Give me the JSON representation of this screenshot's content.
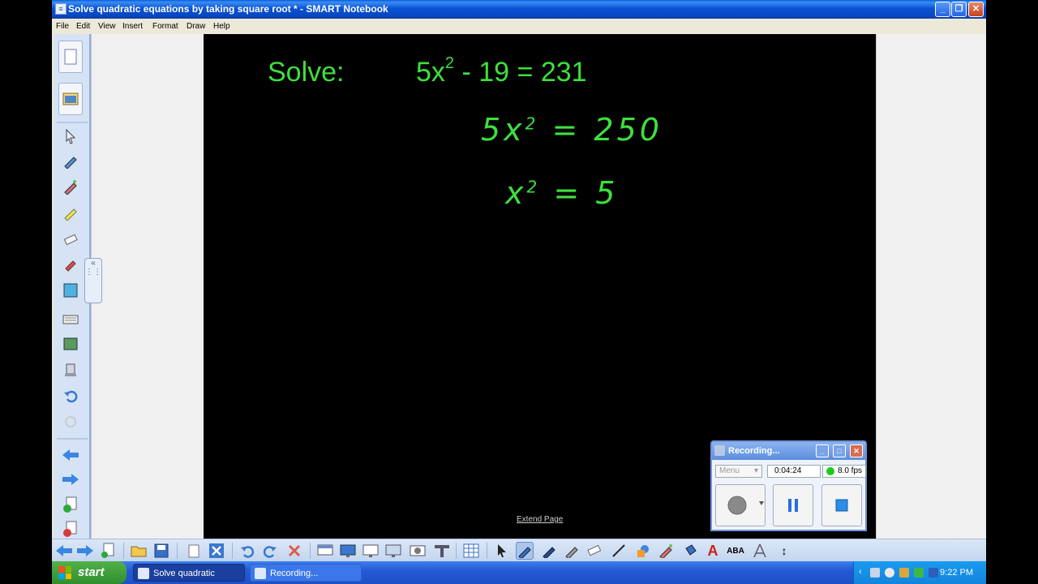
{
  "window": {
    "title": "Solve quadratic equations by taking square root * - SMART Notebook"
  },
  "menu": [
    "File",
    "Edit",
    "View",
    "Insert",
    "Format",
    "Draw",
    "Help"
  ],
  "canvas": {
    "solve_label": "Solve:",
    "equation_base": "5x",
    "equation_exp": "2",
    "equation_rest": " - 19 = 231",
    "step1_left": "5x",
    "step1_exp": "2",
    "step1_right": " = 250",
    "step2_left": "x",
    "step2_exp": "2",
    "step2_right": " = 5",
    "extend_page": "Extend Page"
  },
  "recorder": {
    "title": "Recording...",
    "menu_label": "Menu",
    "time": "0:04:24",
    "fps": "8.0 fps"
  },
  "taskbar": {
    "start": "start",
    "tasks": [
      "Solve quadratic equa...",
      "Recording..."
    ],
    "clock": "9:22 PM"
  },
  "colors": {
    "ink": "#3de03d",
    "titlebar": "#0a53d4",
    "taskbar": "#2459d4",
    "start": "#3a9a36"
  }
}
